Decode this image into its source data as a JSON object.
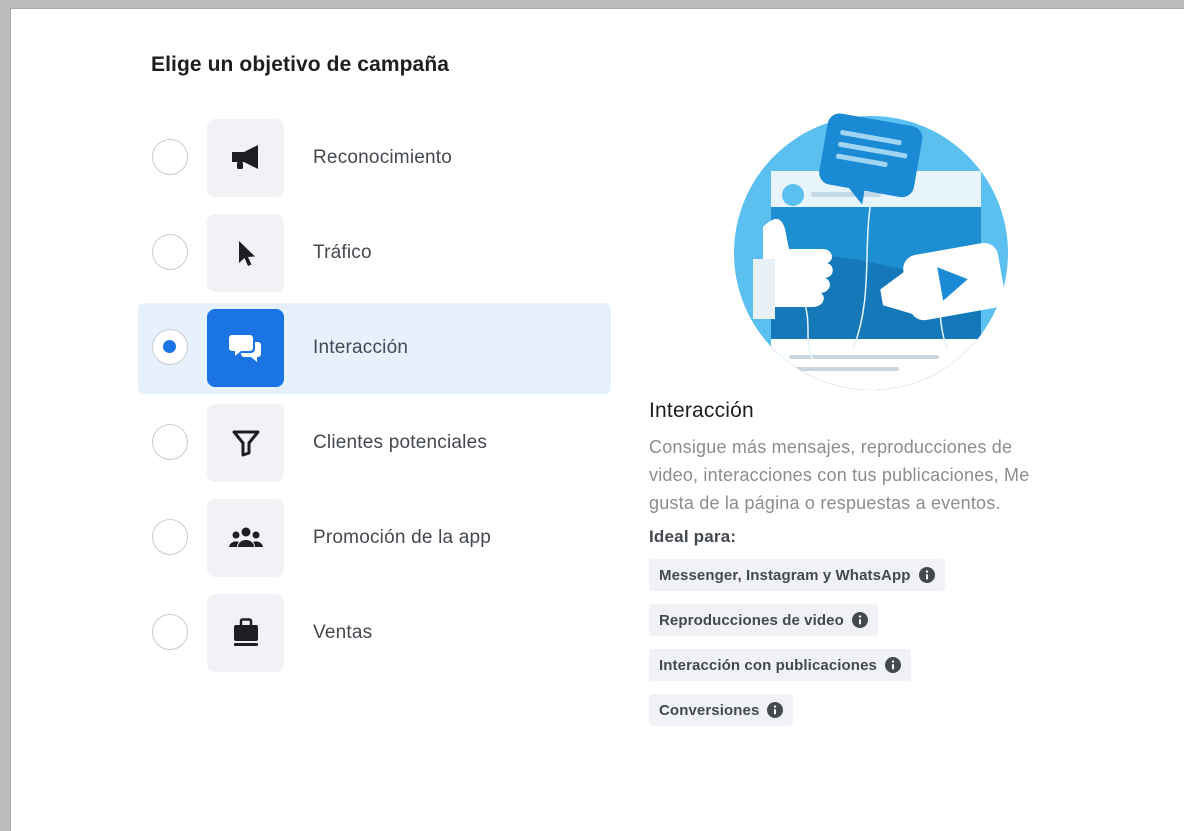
{
  "page": {
    "title": "Elige un objetivo de campaña"
  },
  "objectives": [
    {
      "label": "Reconocimiento",
      "icon": "megaphone-icon",
      "selected": false
    },
    {
      "label": "Tráfico",
      "icon": "cursor-icon",
      "selected": false
    },
    {
      "label": "Interacción",
      "icon": "chat-bubbles-icon",
      "selected": true
    },
    {
      "label": "Clientes potenciales",
      "icon": "funnel-icon",
      "selected": false
    },
    {
      "label": "Promoción de la app",
      "icon": "people-icon",
      "selected": false
    },
    {
      "label": "Ventas",
      "icon": "briefcase-icon",
      "selected": false
    }
  ],
  "detail": {
    "title": "Interacción",
    "description": "Consigue más mensajes, reproducciones de video, interacciones con tus publicaciones, Me gusta de la página o respuestas a eventos.",
    "ideal_label": "Ideal para:",
    "chips": [
      {
        "label": "Messenger, Instagram y WhatsApp"
      },
      {
        "label": "Reproducciones de video"
      },
      {
        "label": "Interacción con publicaciones"
      },
      {
        "label": "Conversiones"
      }
    ]
  },
  "colors": {
    "accent": "#1b74e4",
    "selected_bg": "#e7f0fd",
    "icon_bg": "#f0f2f5",
    "text_primary": "#1c1e21",
    "text_secondary": "#8a8d91"
  }
}
